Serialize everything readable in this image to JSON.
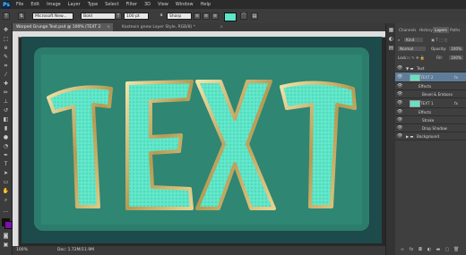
{
  "menu": {
    "logo": "Ps",
    "items": [
      "File",
      "Edit",
      "Image",
      "Layer",
      "Type",
      "Select",
      "Filter",
      "3D",
      "View",
      "Window",
      "Help"
    ]
  },
  "options": {
    "font_family": "Microsoft New...",
    "font_style": "Bold",
    "font_size": "100 pt",
    "antialias": "Sharp"
  },
  "tabs": [
    {
      "label": "Warped Grunge Text.psd @ 100% (TEXT 2"
    },
    {
      "label": "Kasteoin gnew Layer Style, RGB/8) *"
    }
  ],
  "canvas": {
    "text": [
      "T",
      "E",
      "X",
      "T"
    ],
    "colors": {
      "background": "#1f4e4c",
      "grunge": "#2c7c6c",
      "letter_fill": "#5ee6c8",
      "bevel": "#cdb877"
    }
  },
  "status": {
    "zoom": "100%",
    "doc": "Doc: 1.72M/11.9M"
  },
  "panel": {
    "tabs": [
      "Channels",
      "History",
      "Layers",
      "Paths"
    ],
    "active_tab": "Layers",
    "kind": "Kind",
    "blend_mode": "Normal",
    "opacity_label": "Opacity:",
    "opacity_value": "100%",
    "lock_label": "Lock:",
    "fill_label": "Fill:",
    "fill_value": "100%",
    "layers": [
      {
        "name": "Text",
        "type": "group"
      },
      {
        "name": "TEXT 2",
        "type": "text",
        "selected": true
      },
      {
        "name": "Effects",
        "type": "effects"
      },
      {
        "name": "Bevel & Emboss",
        "type": "effect"
      },
      {
        "name": "TEXT 1",
        "type": "text"
      },
      {
        "name": "Effects",
        "type": "effects"
      },
      {
        "name": "Stroke",
        "type": "effect"
      },
      {
        "name": "Drop Shadow",
        "type": "effect"
      },
      {
        "name": "Background",
        "type": "group"
      }
    ]
  },
  "colors": {
    "foreground": "#111111",
    "background": "#7a12a8",
    "swatch": "#5ee6c8"
  }
}
